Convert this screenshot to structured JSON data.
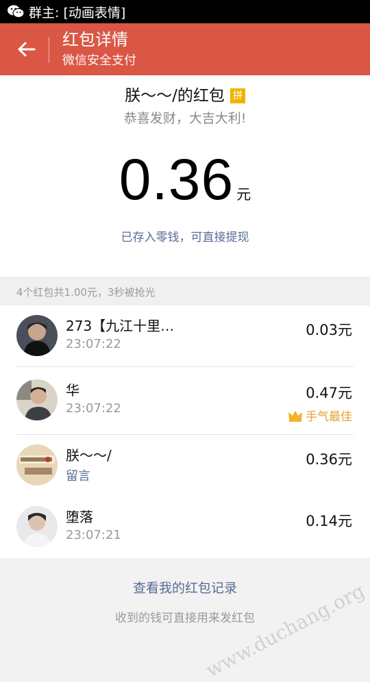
{
  "status_bar": {
    "app_icon": "wechat-icon",
    "title": "群主: [动画表情]"
  },
  "header": {
    "back_icon": "back-arrow-icon",
    "title": "红包详情",
    "subtitle": "微信安全支付"
  },
  "summary": {
    "sender": "朕～～/的红包",
    "pin_badge": "拼",
    "wish": "恭喜发财，大吉大利!",
    "amount": "0.36",
    "unit": "元",
    "deposit_link": "已存入零钱，可直接提现"
  },
  "group_info": "4个红包共1.00元，3秒被抢光",
  "recipients": [
    {
      "name": "273【九江十里…",
      "time": "23:07:22",
      "amount": "0.03元"
    },
    {
      "name": "华",
      "time": "23:07:22",
      "amount": "0.47元",
      "best_label": "手气最佳"
    },
    {
      "name": "朕～～/",
      "message": "留言",
      "amount": "0.36元"
    },
    {
      "name": "堕落",
      "time": "23:07:21",
      "amount": "0.14元"
    }
  ],
  "footer": {
    "record_link": "查看我的红包记录",
    "tip": "收到的钱可直接用来发红包"
  },
  "watermark": "www.duchang.org",
  "colors": {
    "header": "#d95744",
    "link": "#576b95",
    "best": "#e3a32e"
  }
}
